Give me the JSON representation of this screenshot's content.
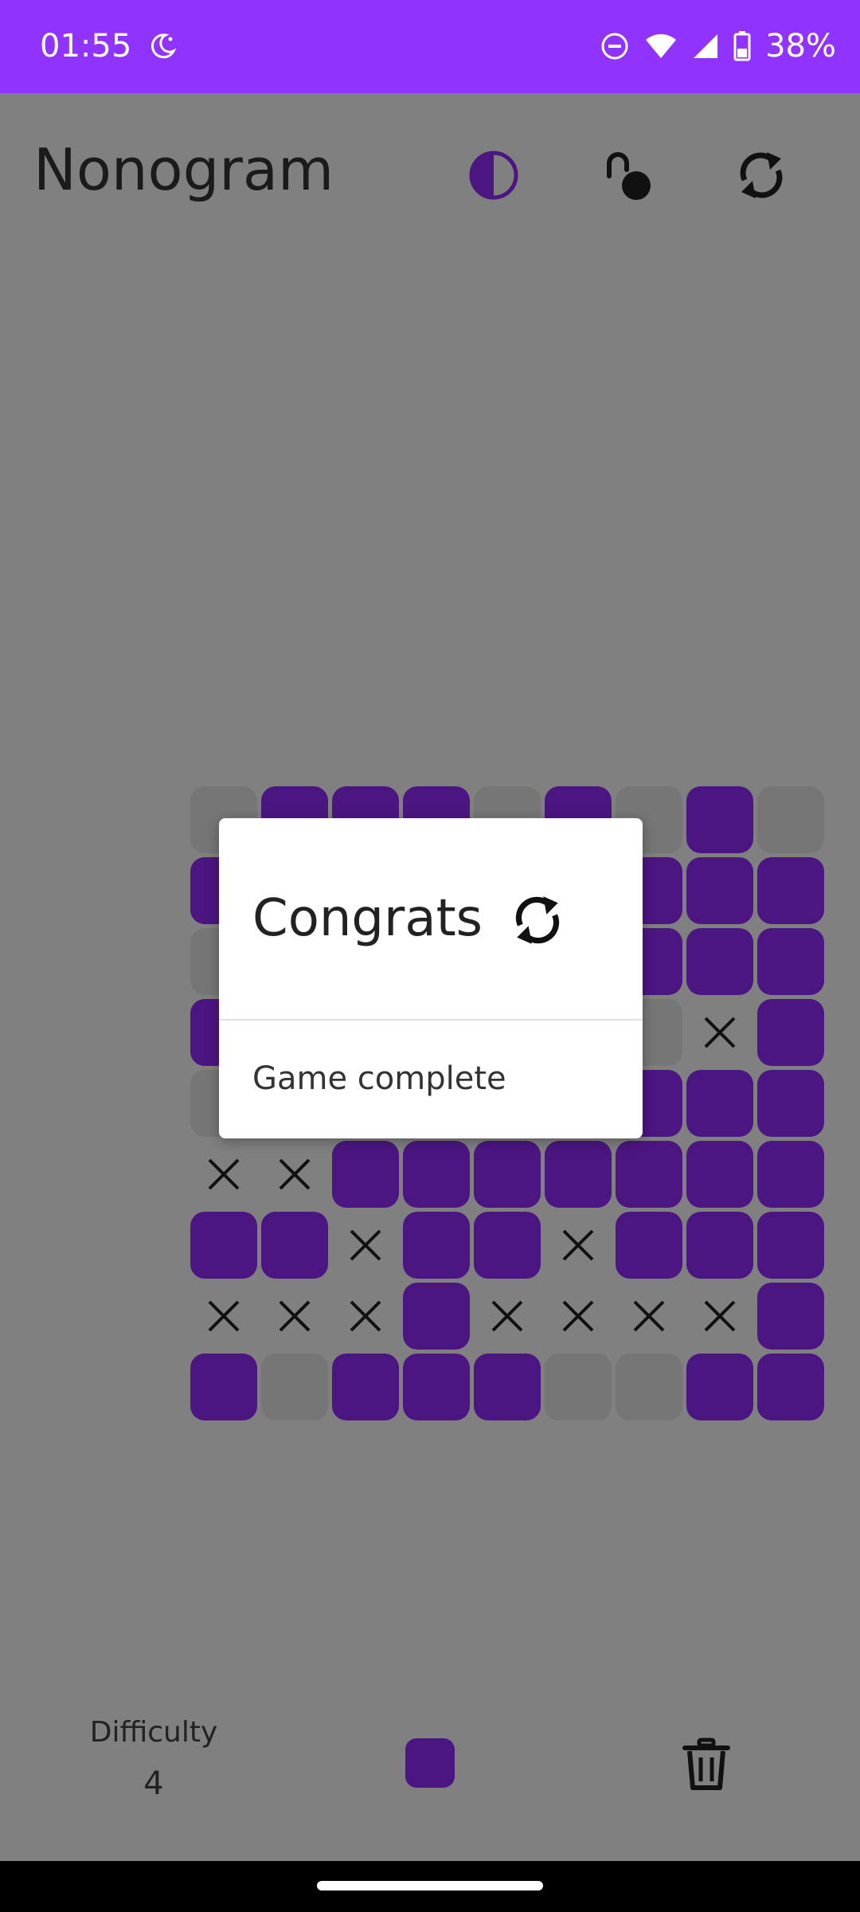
{
  "status_bar": {
    "time": "01:55",
    "battery": "38%",
    "left_icons": [
      "moon-icon"
    ],
    "right_icons": [
      "do-not-disturb-icon",
      "wifi-icon",
      "signal-icon",
      "battery-icon"
    ],
    "color": "#9133FF"
  },
  "header": {
    "title": "Nonogram",
    "icons": [
      "theme-contrast-icon",
      "unlock-icon",
      "refresh-icon"
    ]
  },
  "board": {
    "rows": 9,
    "cols": 9,
    "filled_color": "#4C1682",
    "empty_color": "#767676",
    "cells": [
      [
        "empty",
        "filled",
        "filled",
        "filled",
        "empty",
        "filled",
        "empty",
        "filled",
        "empty"
      ],
      [
        "filled",
        "empty",
        "empty",
        "empty",
        "empty",
        "empty",
        "filled",
        "filled",
        "filled"
      ],
      [
        "empty",
        "empty",
        "empty",
        "empty",
        "empty",
        "empty",
        "filled",
        "filled",
        "filled"
      ],
      [
        "filled",
        "empty",
        "empty",
        "empty",
        "empty",
        "empty",
        "empty",
        "x",
        "filled"
      ],
      [
        "empty",
        "empty",
        "empty",
        "empty",
        "empty",
        "empty",
        "filled",
        "filled",
        "filled"
      ],
      [
        "x",
        "x",
        "filled",
        "filled",
        "filled",
        "filled",
        "filled",
        "filled",
        "filled"
      ],
      [
        "filled",
        "filled",
        "x",
        "filled",
        "filled",
        "x",
        "filled",
        "filled",
        "filled"
      ],
      [
        "x",
        "x",
        "x",
        "filled",
        "x",
        "x",
        "x",
        "x",
        "filled"
      ],
      [
        "filled",
        "empty",
        "filled",
        "filled",
        "filled",
        "empty",
        "empty",
        "filled",
        "filled"
      ]
    ]
  },
  "dialog": {
    "title": "Congrats",
    "message": "Game complete",
    "icon": "refresh-icon"
  },
  "footer": {
    "difficulty_label": "Difficulty",
    "difficulty_value": "4",
    "mode_icon": "fill-mode-swatch",
    "trash_icon": "trash-icon"
  }
}
